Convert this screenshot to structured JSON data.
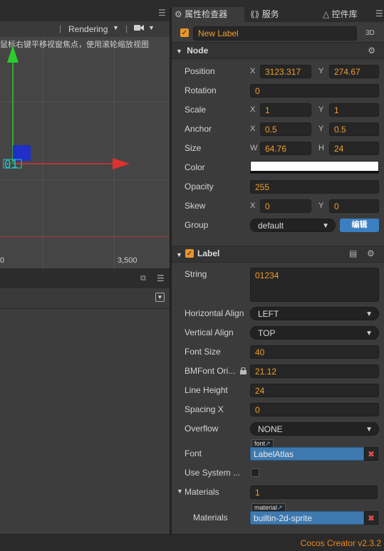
{
  "scene": {
    "rendering_label": "Rendering",
    "hint_text": "鼠标右键平移视窗焦点，使用滚轮缩放视图",
    "axis_tick_left": "0",
    "axis_tick_right": "3,500",
    "gizmo_label": "01"
  },
  "tabs": [
    {
      "label": "属性检查器"
    },
    {
      "label": "服务"
    },
    {
      "label": "控件库"
    }
  ],
  "node_header": {
    "name": "New Label",
    "mode": "3D"
  },
  "node": {
    "title": "Node",
    "position": {
      "label": "Position",
      "x_axis": "X",
      "x": "3123.317",
      "y_axis": "Y",
      "y": "274.67"
    },
    "rotation": {
      "label": "Rotation",
      "value": "0"
    },
    "scale": {
      "label": "Scale",
      "x_axis": "X",
      "x": "1",
      "y_axis": "Y",
      "y": "1"
    },
    "anchor": {
      "label": "Anchor",
      "x_axis": "X",
      "x": "0.5",
      "y_axis": "Y",
      "y": "0.5"
    },
    "size": {
      "label": "Size",
      "w_axis": "W",
      "w": "64.76",
      "h_axis": "H",
      "h": "24"
    },
    "color": {
      "label": "Color",
      "value": "#ffffff"
    },
    "opacity": {
      "label": "Opacity",
      "value": "255"
    },
    "skew": {
      "label": "Skew",
      "x_axis": "X",
      "x": "0",
      "y_axis": "Y",
      "y": "0"
    },
    "group": {
      "label": "Group",
      "value": "default",
      "edit_button": "编辑"
    }
  },
  "label": {
    "title": "Label",
    "string": {
      "label": "String",
      "value": "01234"
    },
    "h_align": {
      "label": "Horizontal Align",
      "value": "LEFT"
    },
    "v_align": {
      "label": "Vertical Align",
      "value": "TOP"
    },
    "font_size": {
      "label": "Font Size",
      "value": "40"
    },
    "bmfont": {
      "label": "BMFont Ori...",
      "value": "21.12"
    },
    "line_height": {
      "label": "Line Height",
      "value": "24"
    },
    "spacing_x": {
      "label": "Spacing X",
      "value": "0"
    },
    "overflow": {
      "label": "Overflow",
      "value": "NONE"
    },
    "font": {
      "label": "Font",
      "tag": "font",
      "value": "LabelAtlas"
    },
    "use_system": {
      "label": "Use System ..."
    },
    "materials": {
      "label": "Materials",
      "count": "1"
    },
    "material_item": {
      "label": "Materials",
      "tag": "material",
      "value": "builtin-2d-sprite"
    }
  },
  "status": {
    "version": "Cocos Creator v2.3.2"
  },
  "colors": {
    "accent": "#ee9d2e",
    "asset_blue": "#3e7ab0",
    "edit_button": "#3a7fc1"
  }
}
